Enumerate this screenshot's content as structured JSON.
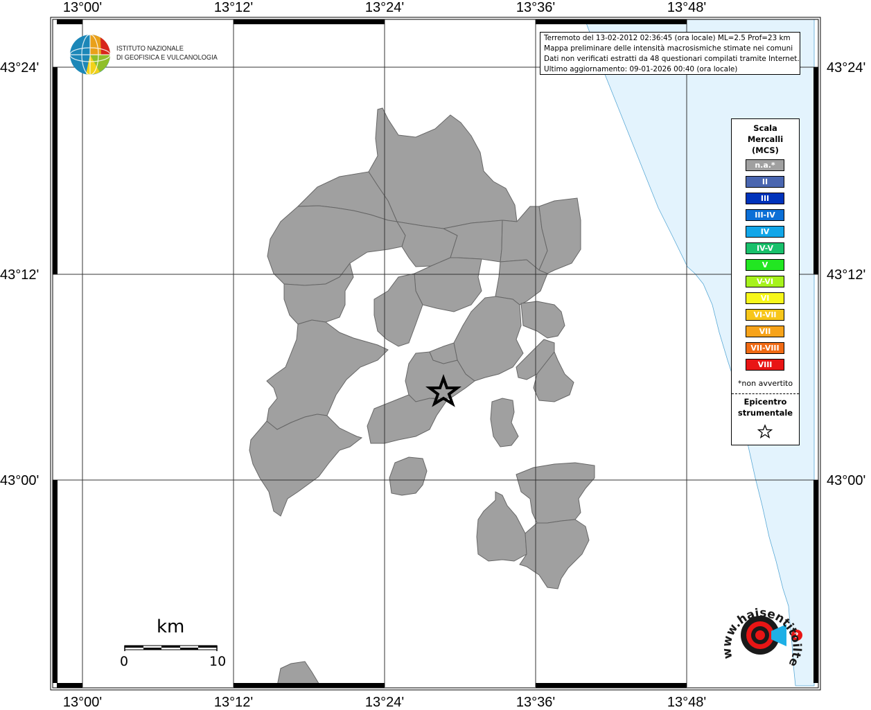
{
  "map": {
    "lon_labels": [
      "13°00'",
      "13°12'",
      "13°24'",
      "13°36'",
      "13°48'"
    ],
    "lat_labels": [
      "43°24'",
      "43°12'",
      "43°00'"
    ]
  },
  "info_box": {
    "line1": "Terremoto del 13-02-2012 02:36:45 (ora locale) ML=2.5 Prof=23 km",
    "line2": "Mappa preliminare delle intensità macrosismiche stimate nei comuni",
    "line3": "Dati non verificati estratti da 48 questionari compilati tramite Internet.",
    "line4": "Ultimo aggiornamento: 09-01-2026 00:40 (ora locale)"
  },
  "legend": {
    "title_line1": "Scala",
    "title_line2": "Mercalli",
    "title_line3": "(MCS)",
    "items": [
      {
        "label": "n.a.*",
        "color": "#a0a0a0"
      },
      {
        "label": "II",
        "color": "#4a66b0"
      },
      {
        "label": "III",
        "color": "#0033bb"
      },
      {
        "label": "III-IV",
        "color": "#0c6fd6"
      },
      {
        "label": "IV",
        "color": "#12a6e8"
      },
      {
        "label": "IV-V",
        "color": "#19c06b"
      },
      {
        "label": "V",
        "color": "#22e622"
      },
      {
        "label": "V-VI",
        "color": "#a6f21c"
      },
      {
        "label": "VI",
        "color": "#f7f71a"
      },
      {
        "label": "VI-VII",
        "color": "#f7c61a"
      },
      {
        "label": "VII",
        "color": "#f7a31a"
      },
      {
        "label": "VII-VIII",
        "color": "#f06a14"
      },
      {
        "label": "VIII",
        "color": "#e81515"
      }
    ],
    "na_note": "*non avvertito",
    "epicenter_line1": "Epicentro",
    "epicenter_line2": "strumentale"
  },
  "ingv": {
    "line1": "ISTITUTO NAZIONALE",
    "line2": "DI GEOFISICA E VULCANOLOGIA"
  },
  "scale_bar": {
    "unit": "km",
    "start": "0",
    "end": "10"
  },
  "hsit_logo": {
    "text": "www.haisentitoilterremoto.it"
  },
  "colors": {
    "sea": "#e3f3fd",
    "municipality": "#a0a0a0",
    "grid": "#000000"
  }
}
